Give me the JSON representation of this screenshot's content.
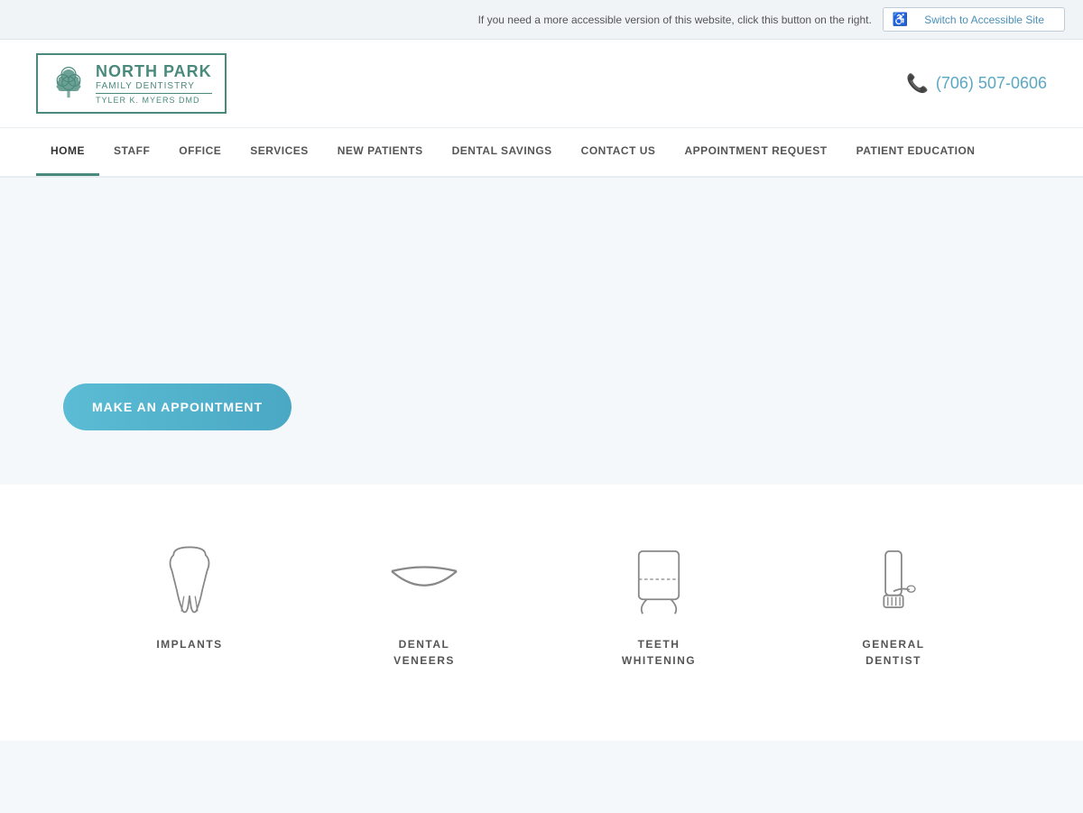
{
  "accessibility": {
    "message": "If you need a more accessible version of this website, click this button on the right.",
    "link_text": "Switch to Accessible Site"
  },
  "header": {
    "logo": {
      "title": "NORTH PARK",
      "subtitle": "FAMILY DENTISTRY",
      "name": "TYLER K. MYERS DMD"
    },
    "phone": "(706) 507-0606"
  },
  "nav": {
    "items": [
      {
        "label": "HOME",
        "active": true
      },
      {
        "label": "STAFF",
        "active": false
      },
      {
        "label": "OFFICE",
        "active": false
      },
      {
        "label": "SERVICES",
        "active": false
      },
      {
        "label": "NEW PATIENTS",
        "active": false
      },
      {
        "label": "DENTAL SAVINGS",
        "active": false
      },
      {
        "label": "CONTACT US",
        "active": false
      },
      {
        "label": "APPOINTMENT REQUEST",
        "active": false
      },
      {
        "label": "PATIENT EDUCATION",
        "active": false
      }
    ]
  },
  "hero": {
    "cta_label": "MAKE AN APPOINTMENT"
  },
  "services": {
    "items": [
      {
        "label": "IMPLANTS",
        "icon": "tooth"
      },
      {
        "label": "DENTAL\nVENEERS",
        "icon": "veneers"
      },
      {
        "label": "TEETH\nWHITENING",
        "icon": "whitening"
      },
      {
        "label": "GENERAL\nDENTIST",
        "icon": "general"
      }
    ]
  }
}
